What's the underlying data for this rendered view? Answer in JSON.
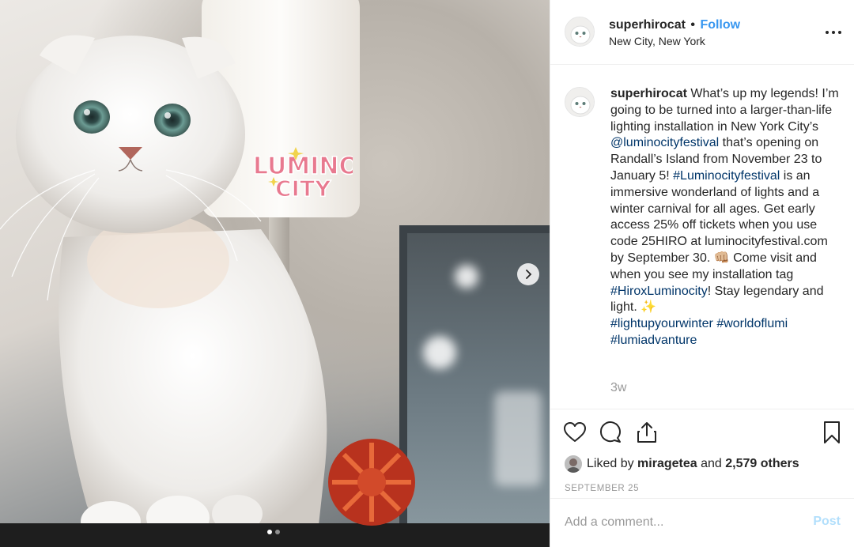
{
  "header": {
    "username": "superhirocat",
    "separator": "•",
    "follow_label": "Follow",
    "location": "New City, New York"
  },
  "caption": {
    "username": "superhirocat",
    "part1": " What’s up my legends! I’m going to be turned into a larger-than-life lighting installation in New York City’s ",
    "mention": "@luminocityfestival",
    "part2": " that’s opening on Randall’s Island from November 23 to January 5! ",
    "hashtag1": "#Luminocityfestival",
    "part3": " is an immersive wonderland of lights and a winter carnival for all ages. Get early access 25% off tickets when you use code 25HIRO at luminocityfestival.com by September 30. 👊🏼  Come visit and when you see my installation tag ",
    "hashtag2": "#HiroxLuminocity",
    "part4": "! Stay legendary and light. ✨",
    "hashtag3": "#lightupyourwinter",
    "hashtag4": "#worldoflumi",
    "hashtag5": "#lumiadvanture",
    "time_ago": "3w"
  },
  "likes": {
    "prefix": "Liked by ",
    "liker": "miragetea",
    "middle": " and ",
    "others": "2,579 others"
  },
  "date": "SEPTEMBER 25",
  "comment": {
    "placeholder": "Add a comment...",
    "post_label": "Post"
  },
  "sticker": {
    "text_top": "LUMINO",
    "text_bottom": "CITY"
  },
  "icons": {
    "like": "heart-icon",
    "comment": "comment-icon",
    "share": "share-icon",
    "save": "bookmark-icon",
    "more": "more-options-icon",
    "next": "chevron-right-icon"
  },
  "carousel": {
    "slides": 2,
    "active": 1
  },
  "colors": {
    "link": "#003569",
    "follow": "#3897f0",
    "muted": "#999999",
    "post_disabled": "#b2dffc",
    "sticker_pink": "#e8798f"
  }
}
